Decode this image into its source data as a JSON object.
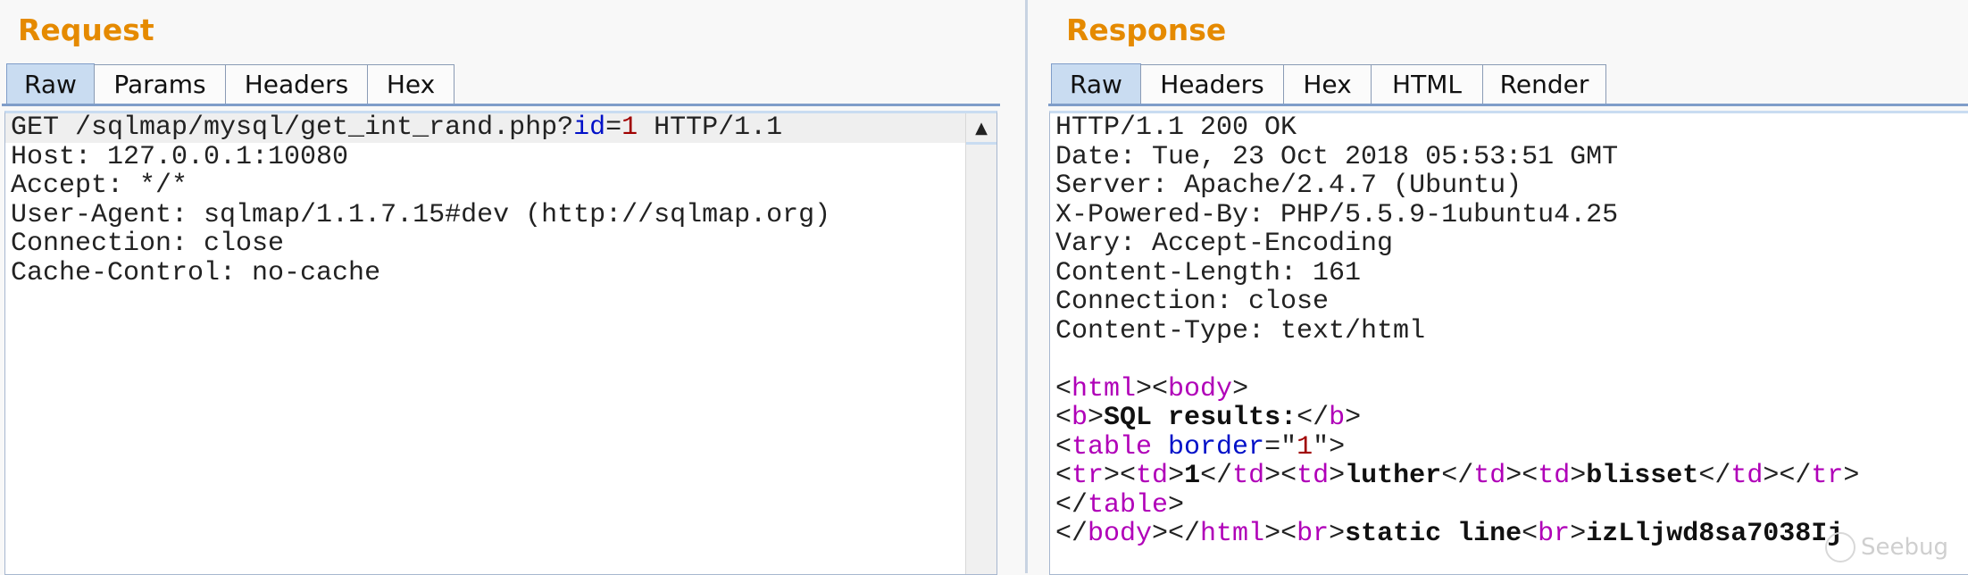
{
  "request": {
    "title": "Request",
    "tabs": [
      {
        "label": "Raw",
        "active": true
      },
      {
        "label": "Params",
        "active": false
      },
      {
        "label": "Headers",
        "active": false
      },
      {
        "label": "Hex",
        "active": false
      }
    ],
    "lines": [
      [
        {
          "t": "GET /sqlmap/mysql/get_int_rand.php?",
          "k": "plain"
        },
        {
          "t": "id",
          "k": "attr"
        },
        {
          "t": "=",
          "k": "plain"
        },
        {
          "t": "1",
          "k": "val"
        },
        {
          "t": " HTTP/1.1",
          "k": "plain"
        }
      ],
      [
        {
          "t": "Host: 127.0.0.1:10080",
          "k": "plain"
        }
      ],
      [
        {
          "t": "Accept: */*",
          "k": "plain"
        }
      ],
      [
        {
          "t": "User-Agent: sqlmap/1.1.7.15#dev (http://sqlmap.org)",
          "k": "plain"
        }
      ],
      [
        {
          "t": "Connection: close",
          "k": "plain"
        }
      ],
      [
        {
          "t": "Cache-Control: no-cache",
          "k": "plain"
        }
      ]
    ],
    "scroll_up_icon": "▲"
  },
  "response": {
    "title": "Response",
    "tabs": [
      {
        "label": "Raw",
        "active": true
      },
      {
        "label": "Headers",
        "active": false
      },
      {
        "label": "Hex",
        "active": false
      },
      {
        "label": "HTML",
        "active": false
      },
      {
        "label": "Render",
        "active": false
      }
    ],
    "lines": [
      [
        {
          "t": "HTTP/1.1 200 OK",
          "k": "plain"
        }
      ],
      [
        {
          "t": "Date: Tue, 23 Oct 2018 05:53:51 GMT",
          "k": "plain"
        }
      ],
      [
        {
          "t": "Server: Apache/2.4.7 (Ubuntu)",
          "k": "plain"
        }
      ],
      [
        {
          "t": "X-Powered-By: PHP/5.5.9-1ubuntu4.25",
          "k": "plain"
        }
      ],
      [
        {
          "t": "Vary: Accept-Encoding",
          "k": "plain"
        }
      ],
      [
        {
          "t": "Content-Length: 161",
          "k": "plain"
        }
      ],
      [
        {
          "t": "Connection: close",
          "k": "plain"
        }
      ],
      [
        {
          "t": "Content-Type: text/html",
          "k": "plain"
        }
      ],
      [],
      [
        {
          "t": "<",
          "k": "plain"
        },
        {
          "t": "html",
          "k": "tag"
        },
        {
          "t": "><",
          "k": "plain"
        },
        {
          "t": "body",
          "k": "tag"
        },
        {
          "t": ">",
          "k": "plain"
        }
      ],
      [
        {
          "t": "<",
          "k": "plain"
        },
        {
          "t": "b",
          "k": "tag"
        },
        {
          "t": ">",
          "k": "plain"
        },
        {
          "t": "SQL results:",
          "k": "bold"
        },
        {
          "t": "</",
          "k": "plain"
        },
        {
          "t": "b",
          "k": "tag"
        },
        {
          "t": ">",
          "k": "plain"
        }
      ],
      [
        {
          "t": "<",
          "k": "plain"
        },
        {
          "t": "table",
          "k": "tag"
        },
        {
          "t": " ",
          "k": "plain"
        },
        {
          "t": "border",
          "k": "attr"
        },
        {
          "t": "=\"",
          "k": "plain"
        },
        {
          "t": "1",
          "k": "val"
        },
        {
          "t": "\">",
          "k": "plain"
        }
      ],
      [
        {
          "t": "<",
          "k": "plain"
        },
        {
          "t": "tr",
          "k": "tag"
        },
        {
          "t": "><",
          "k": "plain"
        },
        {
          "t": "td",
          "k": "tag"
        },
        {
          "t": ">",
          "k": "plain"
        },
        {
          "t": "1",
          "k": "bold"
        },
        {
          "t": "</",
          "k": "plain"
        },
        {
          "t": "td",
          "k": "tag"
        },
        {
          "t": "><",
          "k": "plain"
        },
        {
          "t": "td",
          "k": "tag"
        },
        {
          "t": ">",
          "k": "plain"
        },
        {
          "t": "luther",
          "k": "bold"
        },
        {
          "t": "</",
          "k": "plain"
        },
        {
          "t": "td",
          "k": "tag"
        },
        {
          "t": "><",
          "k": "plain"
        },
        {
          "t": "td",
          "k": "tag"
        },
        {
          "t": ">",
          "k": "plain"
        },
        {
          "t": "blisset",
          "k": "bold"
        },
        {
          "t": "</",
          "k": "plain"
        },
        {
          "t": "td",
          "k": "tag"
        },
        {
          "t": "></",
          "k": "plain"
        },
        {
          "t": "tr",
          "k": "tag"
        },
        {
          "t": ">",
          "k": "plain"
        }
      ],
      [
        {
          "t": "</",
          "k": "plain"
        },
        {
          "t": "table",
          "k": "tag"
        },
        {
          "t": ">",
          "k": "plain"
        }
      ],
      [
        {
          "t": "</",
          "k": "plain"
        },
        {
          "t": "body",
          "k": "tag"
        },
        {
          "t": "></",
          "k": "plain"
        },
        {
          "t": "html",
          "k": "tag"
        },
        {
          "t": "><",
          "k": "plain"
        },
        {
          "t": "br",
          "k": "tag"
        },
        {
          "t": ">",
          "k": "plain"
        },
        {
          "t": "static line",
          "k": "bold"
        },
        {
          "t": "<",
          "k": "plain"
        },
        {
          "t": "br",
          "k": "tag"
        },
        {
          "t": ">",
          "k": "plain"
        },
        {
          "t": "izLljwd8sa7038Ij",
          "k": "bold"
        }
      ]
    ]
  },
  "watermark": "Seebug",
  "colors": {
    "title": "#e58a00",
    "tag": "#b000b8",
    "attribute": "#0010c8",
    "value": "#a00000",
    "active_tab": "#c9dcf1"
  }
}
